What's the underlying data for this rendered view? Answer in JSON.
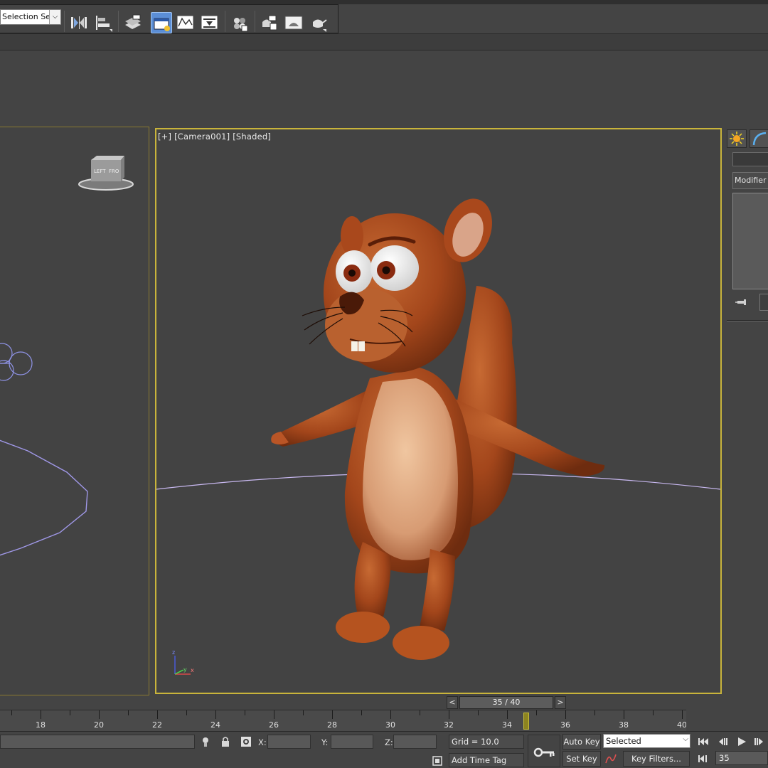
{
  "toolbar": {
    "selection_set_value": "Selection Se",
    "dropdown_arrow": "⌵"
  },
  "viewport": {
    "label_plus": "[+]",
    "label_camera": "[Camera001]",
    "label_shading": "[Shaded]",
    "viewcube_left": "LEFT",
    "viewcube_front": "FRO"
  },
  "command_panel": {
    "modifier_list": "Modifier L"
  },
  "time_slider": {
    "prev": "<",
    "next": ">",
    "value": "35 / 40"
  },
  "track_bar": {
    "ticks": [
      "18",
      "20",
      "22",
      "24",
      "26",
      "28",
      "30",
      "32",
      "34",
      "36",
      "38",
      "40"
    ]
  },
  "status": {
    "x_label": "X:",
    "y_label": "Y:",
    "z_label": "Z:",
    "grid": "Grid = 10.0",
    "add_time_tag": "Add Time Tag",
    "auto_key": "Auto Key",
    "set_key": "Set Key",
    "selected": "Selected",
    "key_filters": "Key Filters...",
    "current_frame": "35"
  },
  "colors": {
    "viewport_active_border": "#c9b43b",
    "toolbar_active": "#5b8ed6",
    "character_fur": "#a9491c",
    "character_belly": "#e0ad86"
  }
}
